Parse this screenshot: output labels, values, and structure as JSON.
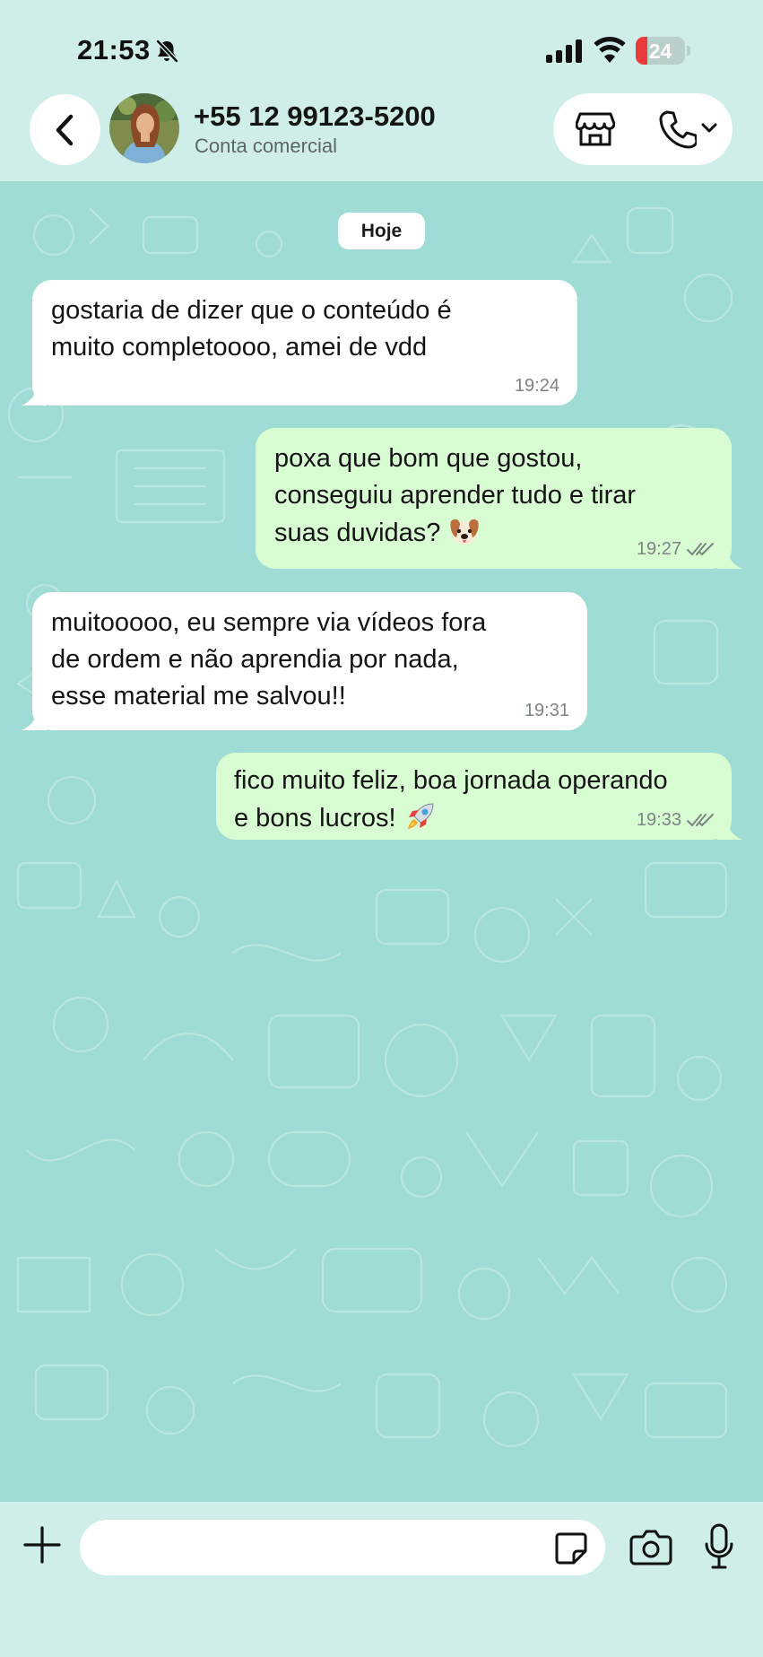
{
  "status_bar": {
    "time": "21:53",
    "battery_level": "24",
    "battery_fraction": 0.24,
    "icons": [
      "bell-slash-icon",
      "signal-icon",
      "wifi-icon",
      "battery-icon"
    ]
  },
  "header": {
    "contact_name": "+55 12 99123-5200",
    "contact_subtitle": "Conta comercial",
    "icons": [
      "chevron-left-icon",
      "store-icon",
      "phone-icon",
      "chevron-down-icon"
    ]
  },
  "chat": {
    "date_label": "Hoje",
    "messages": [
      {
        "direction": "in",
        "lines": [
          "gostaria de dizer que o conteúdo é",
          "muito completoooo, amei de vdd"
        ],
        "time": "19:24"
      },
      {
        "direction": "out",
        "lines": [
          "poxa que bom que gostou,",
          "conseguiu aprender tudo e tirar",
          "suas duvidas?"
        ],
        "emoji": "dog-face-emoji",
        "time": "19:27",
        "status": "read"
      },
      {
        "direction": "in",
        "lines": [
          "muitooooo, eu sempre via vídeos fora",
          "de ordem e não aprendia por nada,",
          "esse material me salvou!!"
        ],
        "time": "19:31"
      },
      {
        "direction": "out",
        "lines": [
          "fico muito feliz, boa jornada operando",
          "e bons lucros!"
        ],
        "emoji": "rocket-emoji",
        "time": "19:33",
        "status": "read"
      }
    ]
  },
  "composer": {
    "placeholder": "",
    "icons": [
      "plus-icon",
      "sticker-icon",
      "camera-icon",
      "microphone-icon"
    ]
  },
  "colors": {
    "status_bg": "#cfeeea",
    "chat_wallpaper": "#9fdcd5",
    "incoming_bubble": "#ffffff",
    "outgoing_bubble": "#d9fdd3",
    "battery_low": "#ea3b3b",
    "read_ticks": "#7b8582"
  }
}
